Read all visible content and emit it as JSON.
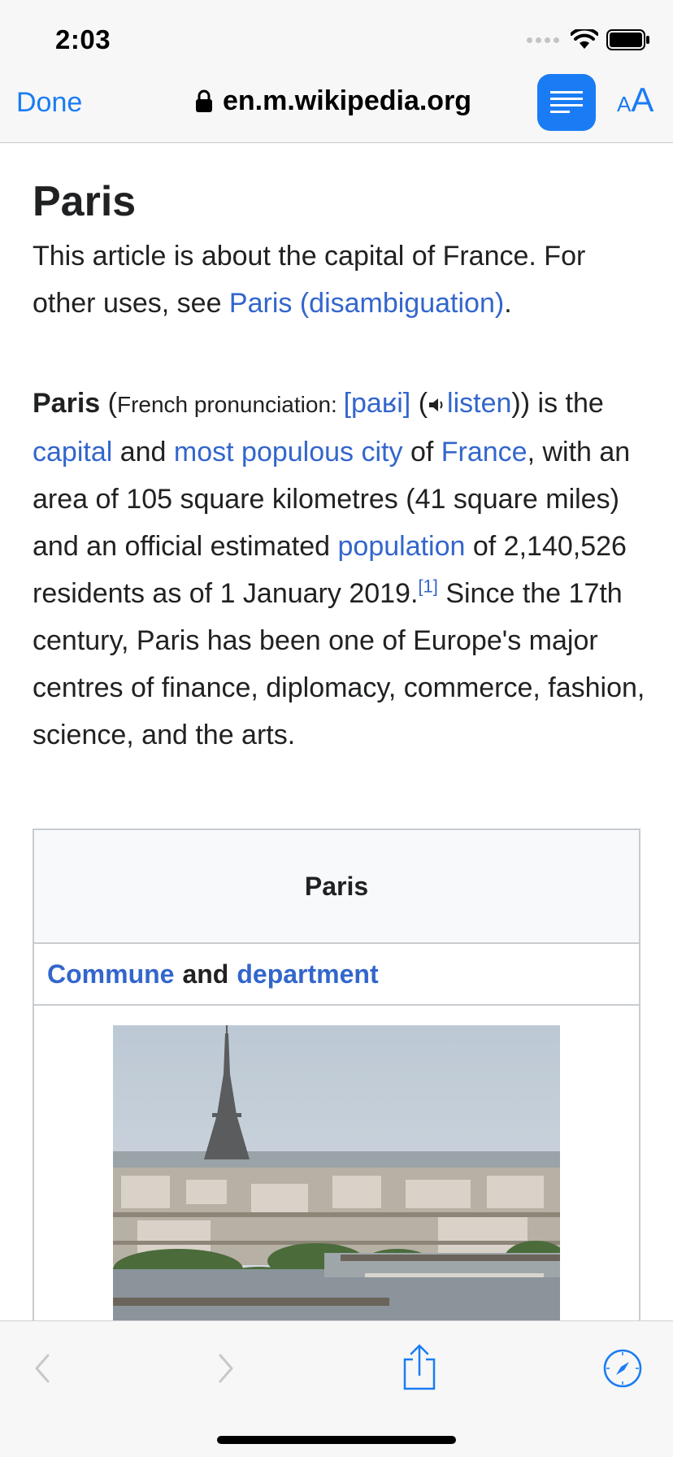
{
  "status_bar": {
    "time": "2:03"
  },
  "browser": {
    "done_label": "Done",
    "url": "en.m.wikipedia.org",
    "text_size_small": "A",
    "text_size_large": "A",
    "accent_color": "#1a7cf4"
  },
  "article": {
    "title": "Paris",
    "hatnote": {
      "before": "This article is about the capital of France. For other uses, see ",
      "link": "Paris (disambiguation)",
      "after": "."
    },
    "lead": {
      "subject": "Paris",
      "pron_open": " (",
      "pron_label": "French pronunciation: ",
      "ipa": "[paʁi]",
      "listen_open": " (",
      "listen": "listen",
      "listen_close": ")) is the ",
      "link_capital": "capital",
      "and": " and ",
      "link_populous": "most populous city",
      "of": " of ",
      "link_france": "France",
      "text_area": ", with an area of 105 square kilometres (41 square miles) and an official estimated ",
      "link_population": "population",
      "text_pop": " of 2,140,526 residents as of 1 January 2019.",
      "ref": "[1]",
      "text_rest": " Since the 17th century, Paris has been one of Europe's major centres of finance, diplomacy, commerce, fashion, science, and the arts."
    },
    "link_color": "#3366cc"
  },
  "infobox": {
    "title": "Paris",
    "link_commune": "Commune",
    "and": "and",
    "link_department": "department"
  },
  "toolbar": {
    "icons": [
      "back-icon",
      "forward-icon",
      "share-icon",
      "compass-icon"
    ]
  }
}
